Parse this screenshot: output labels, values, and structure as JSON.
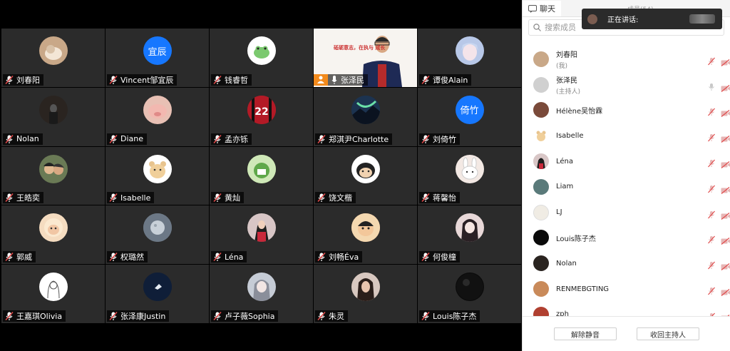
{
  "grid": {
    "tiles": [
      {
        "name": "刘春阳",
        "avatar": "photo-cat",
        "color": "#c9a888"
      },
      {
        "name": "Vincent邹宜辰",
        "avatar_text": "宜辰",
        "color": "#1677ff"
      },
      {
        "name": "钱睿哲",
        "avatar": "frog-cartoon",
        "color": "#ffffff"
      },
      {
        "name": "张泽民",
        "speaking": true
      },
      {
        "name": "谭俊Alain",
        "avatar": "anime-portrait",
        "color": "#b8c8e8"
      },
      {
        "name": "Nolan",
        "avatar": "dark-photo",
        "color": "#2a2420"
      },
      {
        "name": "Diane",
        "avatar": "pink-pig",
        "color": "#e8c0b4"
      },
      {
        "name": "孟亦铄",
        "avatar": "jersey-22",
        "color": "#b31a26"
      },
      {
        "name": "郑淇尹Charlotte",
        "avatar": "aurora-photo",
        "color": "#1c3350"
      },
      {
        "name": "刘倚竹",
        "avatar_text": "倚竹",
        "color": "#1677ff"
      },
      {
        "name": "王皓奕",
        "avatar": "couple-photo",
        "color": "#6a7a55"
      },
      {
        "name": "Isabelle",
        "avatar": "teddy-bear",
        "color": "#ffffff"
      },
      {
        "name": "黄灿",
        "avatar": "green-cartoon",
        "color": "#8fbf6a"
      },
      {
        "name": "饶文楷",
        "avatar": "cartoon-character",
        "color": "#ffffff"
      },
      {
        "name": "蒋馨怡",
        "avatar": "bunny-cartoon",
        "color": "#f3e9e4"
      },
      {
        "name": "郭威",
        "avatar": "sheep-cartoon",
        "color": "#f5dcc0"
      },
      {
        "name": "权璐然",
        "avatar": "moon-photo",
        "color": "#7c8a96"
      },
      {
        "name": "Léna",
        "avatar": "girl-photo",
        "color": "#d8c6c6"
      },
      {
        "name": "刘畅Éva",
        "avatar": "shinchan-cartoon",
        "color": "#e8a070"
      },
      {
        "name": "何俊橦",
        "avatar": "drawn-girl",
        "color": "#e8d8d8"
      },
      {
        "name": "王嘉琪Olivia",
        "avatar": "line-drawing",
        "color": "#ffffff"
      },
      {
        "name": "张泽康Justin",
        "avatar": "night-bird",
        "color": "#0f1e38"
      },
      {
        "name": "卢子薇Sophia",
        "avatar": "girl-drawing",
        "color": "#c6ccd6"
      },
      {
        "name": "朱灵",
        "avatar": "person-photo",
        "color": "#8a6a5a"
      },
      {
        "name": "Louis陈子杰",
        "avatar": "black-sphere",
        "color": "#0a0a0a"
      }
    ],
    "speaker_banner": "砥砺意志，在执与 成长"
  },
  "panel": {
    "tab_chat": "聊天",
    "tab_members": "成员(54)",
    "search_placeholder": "搜索成员",
    "members": [
      {
        "name": "刘春阳",
        "role": "(我)",
        "color": "#c9a888",
        "mic": "muted"
      },
      {
        "name": "张泽民",
        "role": "(主持人)",
        "color": "#d0d0d0",
        "mic": "on"
      },
      {
        "name": "Hélène吴怡霖",
        "color": "#7a4a3a",
        "mic": "muted"
      },
      {
        "name": "Isabelle",
        "color": "#ffffff",
        "mic": "muted"
      },
      {
        "name": "Léna",
        "color": "#d8c6c6",
        "mic": "muted"
      },
      {
        "name": "Liam",
        "color": "#5a7a7a",
        "mic": "muted"
      },
      {
        "name": "LJ",
        "color": "#f0ece4",
        "mic": "muted"
      },
      {
        "name": "Louis陈子杰",
        "color": "#0a0a0a",
        "mic": "muted"
      },
      {
        "name": "Nolan",
        "color": "#2a2420",
        "mic": "muted"
      },
      {
        "name": "RENMEBGTING",
        "color": "#c98a5a",
        "mic": "muted"
      },
      {
        "name": "zph",
        "color": "#b04030",
        "mic": "muted"
      }
    ],
    "unmute_all": "解除静音",
    "reclaim_host": "收回主持人"
  },
  "speaking_popup": {
    "label": "正在讲话:"
  },
  "colors": {
    "muted_red": "#e04a4a",
    "tile_bg": "#2b2b2b",
    "speaker_orange": "#f28a1c"
  }
}
